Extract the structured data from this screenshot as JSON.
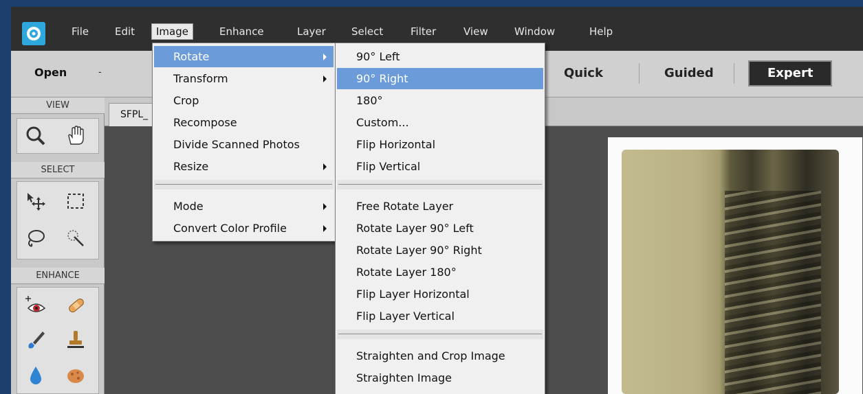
{
  "app": {
    "logo_icon": "elements-logo-icon"
  },
  "menubar": {
    "items": [
      "File",
      "Edit",
      "Image",
      "Enhance",
      "Layer",
      "Select",
      "Filter",
      "View",
      "Window",
      "Help"
    ],
    "active": "Image"
  },
  "options_bar": {
    "open_label": "Open",
    "open_caret": "-",
    "modes": [
      "Quick",
      "Guided",
      "Expert"
    ],
    "selected_mode": "Expert"
  },
  "toolbox": {
    "sections": [
      "VIEW",
      "SELECT",
      "ENHANCE"
    ],
    "tools": [
      "zoom-icon",
      "hand-icon",
      "move-icon",
      "rectangular-marquee-icon",
      "lasso-icon",
      "quick-selection-icon",
      "red-eye-icon",
      "healing-brush-icon",
      "smart-brush-icon",
      "clone-stamp-icon",
      "blur-icon",
      "sponge-icon"
    ]
  },
  "document": {
    "tab_title": "SFPL_"
  },
  "image_menu": {
    "items": [
      {
        "label": "Rotate",
        "submenu": true,
        "highlighted": true
      },
      {
        "label": "Transform",
        "submenu": true
      },
      {
        "label": "Crop",
        "submenu": false
      },
      {
        "label": "Recompose",
        "submenu": false
      },
      {
        "label": "Divide Scanned Photos",
        "submenu": false
      },
      {
        "label": "Resize",
        "submenu": true
      },
      {
        "label": "Mode",
        "submenu": true
      },
      {
        "label": "Convert Color Profile",
        "submenu": true
      }
    ]
  },
  "rotate_submenu": {
    "items": [
      "90° Left",
      "90° Right",
      "180°",
      "Custom...",
      "Flip Horizontal",
      "Flip Vertical",
      "Free Rotate Layer",
      "Rotate Layer 90° Left",
      "Rotate Layer 90° Right",
      "Rotate Layer 180°",
      "Flip Layer Horizontal",
      "Flip Layer Vertical",
      "Straighten and Crop Image",
      "Straighten Image"
    ],
    "highlighted": "90° Right"
  },
  "colors": {
    "highlight": "#6b9bd8",
    "menubar": "#2f2f2f",
    "logo": "#2ea7dc"
  }
}
